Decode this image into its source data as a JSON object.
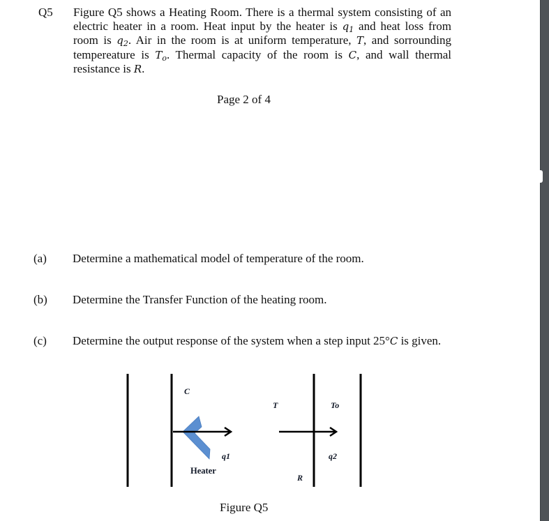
{
  "question": {
    "number": "Q5",
    "body_parts": {
      "p1": "Figure Q5 shows a Heating Room. There is a thermal system consisting of an electric heater in a room. Heat input by the heater is ",
      "q1_sym": "q",
      "q1_sub": "1",
      "p2": " and heat loss from room is ",
      "q2_sym": "q",
      "q2_sub": "2",
      "p3": ". Air in the room is at uniform temperature, ",
      "T_sym": "T",
      "p4": ", and sorrounding tempereature is ",
      "To_sym": "T",
      "To_sub": "o",
      "p5": ". Thermal capacity of the room is ",
      "C_sym": "C",
      "p6": ", and wall thermal resistance is ",
      "R_sym": "R",
      "p7": "."
    }
  },
  "page_indicator": "Page 2 of  4",
  "parts": [
    {
      "label": "(a)",
      "text": "Determine a mathematical model of temperature of the room."
    },
    {
      "label": "(b)",
      "text": "Determine the Transfer Function of the heating room."
    },
    {
      "label": "(c)",
      "text_before": "Determine the output response of the system when a step input 25°",
      "unit_sym": "C",
      "text_after": " is given."
    }
  ],
  "figure": {
    "caption": "Figure Q5",
    "labels": {
      "capacity": "C",
      "room_temp": "T",
      "outside_temp": "To",
      "heat_in": "q1",
      "heat_out": "q2",
      "heater": "Heater",
      "resistance": "R"
    },
    "colors": {
      "heater_fill": "#5b8fd1",
      "heater_stroke": "#4a7dbf",
      "line": "#000000"
    }
  }
}
